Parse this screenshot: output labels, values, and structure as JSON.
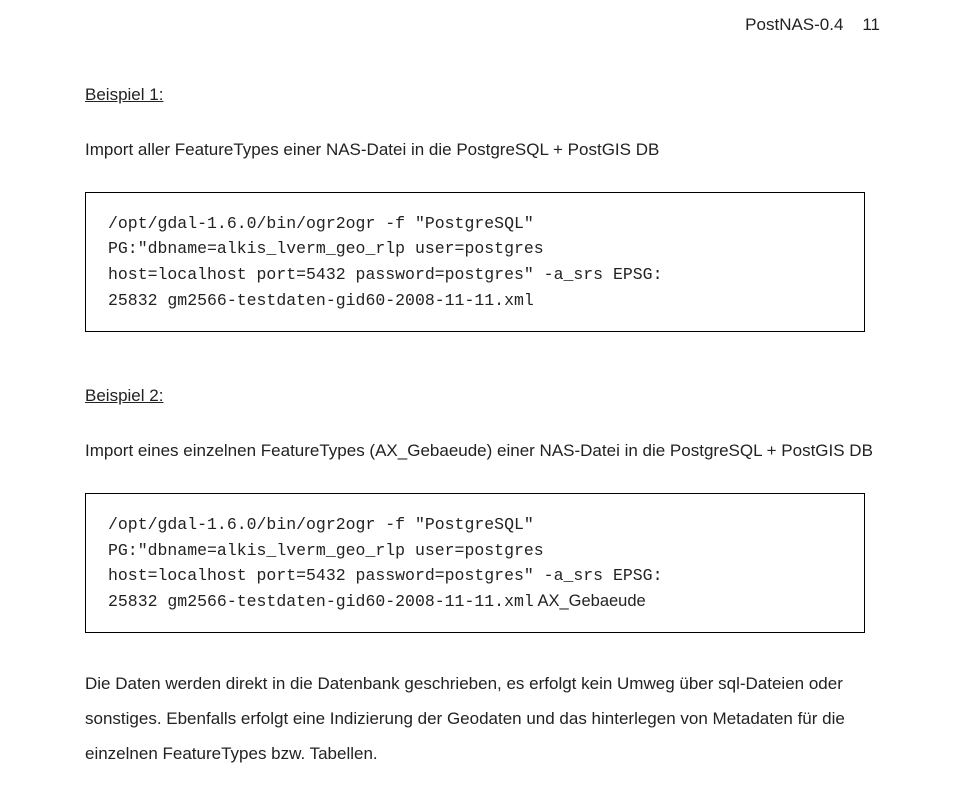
{
  "header": {
    "doc": "PostNAS-0.4",
    "page": "11"
  },
  "example1": {
    "heading": "Beispiel 1:",
    "description": "Import aller FeatureTypes einer NAS-Datei in die PostgreSQL + PostGIS DB",
    "code": "/opt/gdal-1.6.0/bin/ogr2ogr -f \"PostgreSQL\"\nPG:\"dbname=alkis_lverm_geo_rlp user=postgres\nhost=localhost port=5432 password=postgres\" -a_srs EPSG:\n25832 gm2566-testdaten-gid60-2008-11-11.xml"
  },
  "example2": {
    "heading": "Beispiel 2:",
    "description": "Import eines einzelnen FeatureTypes (AX_Gebaeude) einer NAS-Datei in die PostgreSQL + PostGIS DB",
    "code_main": "/opt/gdal-1.6.0/bin/ogr2ogr -f \"PostgreSQL\"\nPG:\"dbname=alkis_lverm_geo_rlp user=postgres\nhost=localhost port=5432 password=postgres\" -a_srs EPSG:\n25832 gm2566-testdaten-gid60-2008-11-11.xml",
    "code_suffix": " AX_Gebaeude"
  },
  "closing": {
    "text": "Die Daten werden direkt in die Datenbank geschrieben, es erfolgt kein Umweg über sql-Dateien oder sonstiges. Ebenfalls erfolgt eine Indizierung der Geodaten und das hinterlegen von Metadaten für die einzelnen FeatureTypes bzw. Tabellen."
  }
}
